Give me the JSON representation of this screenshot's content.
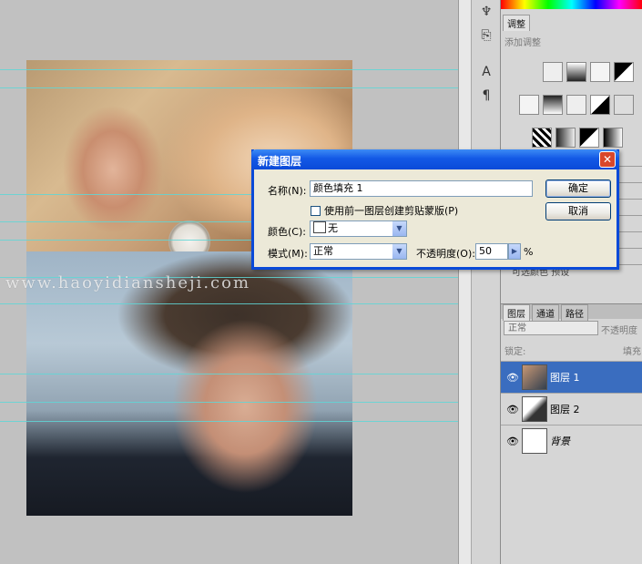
{
  "watermark": "www.haoyidiansheji.com",
  "adjustments_panel": {
    "tab_label": "调整",
    "subtitle": "添加调整",
    "preset_text": "可选颜色 预设"
  },
  "layers_panel": {
    "tabs": [
      "图层",
      "通道",
      "路径"
    ],
    "blend_mode": "正常",
    "opacity_label": "不透明度",
    "lock_label": "锁定:",
    "fill_label": "填充",
    "layers": [
      {
        "name": "图层 1",
        "selected": true
      },
      {
        "name": "图层 2",
        "selected": false
      },
      {
        "name": "背景",
        "selected": false
      }
    ]
  },
  "dialog": {
    "title": "新建图层",
    "name_label": "名称(N):",
    "name_value": "颜色填充 1",
    "clip_checkbox_label": "使用前一图层创建剪贴蒙版(P)",
    "clip_checked": false,
    "color_label": "颜色(C):",
    "color_value": "无",
    "mode_label": "模式(M):",
    "mode_value": "正常",
    "opacity_label": "不透明度(O):",
    "opacity_value": "50",
    "opacity_unit": "%",
    "ok_label": "确定",
    "cancel_label": "取消",
    "close_symbol": "✕"
  },
  "colors": {
    "titlebar_blue": "#0a4ad8",
    "guide_cyan": "#5fd6d6",
    "selected_layer": "#3a6dbf",
    "dialog_bg": "#ece9d8"
  }
}
